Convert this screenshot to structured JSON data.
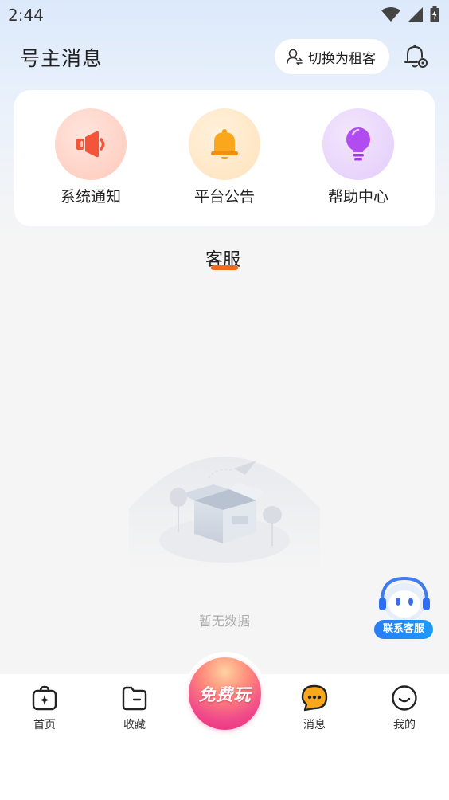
{
  "status_bar": {
    "time": "2:44"
  },
  "header": {
    "title": "号主消息",
    "switch_label": "切换为租客"
  },
  "categories": [
    {
      "label": "系统通知",
      "icon": "speaker-icon",
      "color": "#f4553a",
      "bg": "#ffd6cc"
    },
    {
      "label": "平台公告",
      "icon": "bell-icon",
      "color": "#f7a016",
      "bg": "#ffe9c9"
    },
    {
      "label": "帮助中心",
      "icon": "lightbulb-icon",
      "color": "#b14df0",
      "bg": "#ecd9fb"
    }
  ],
  "tab": {
    "label": "客服",
    "accent": "#f26b1d"
  },
  "empty_state": {
    "text": "暂无数据"
  },
  "float_service": {
    "label": "联系客服"
  },
  "bottom_nav": {
    "items": [
      {
        "label": "首页",
        "icon": "home-bag-icon"
      },
      {
        "label": "收藏",
        "icon": "folder-icon"
      },
      {
        "label": "消息",
        "icon": "message-icon",
        "active": true
      },
      {
        "label": "我的",
        "icon": "smile-icon"
      }
    ],
    "play_label": "免费玩"
  }
}
